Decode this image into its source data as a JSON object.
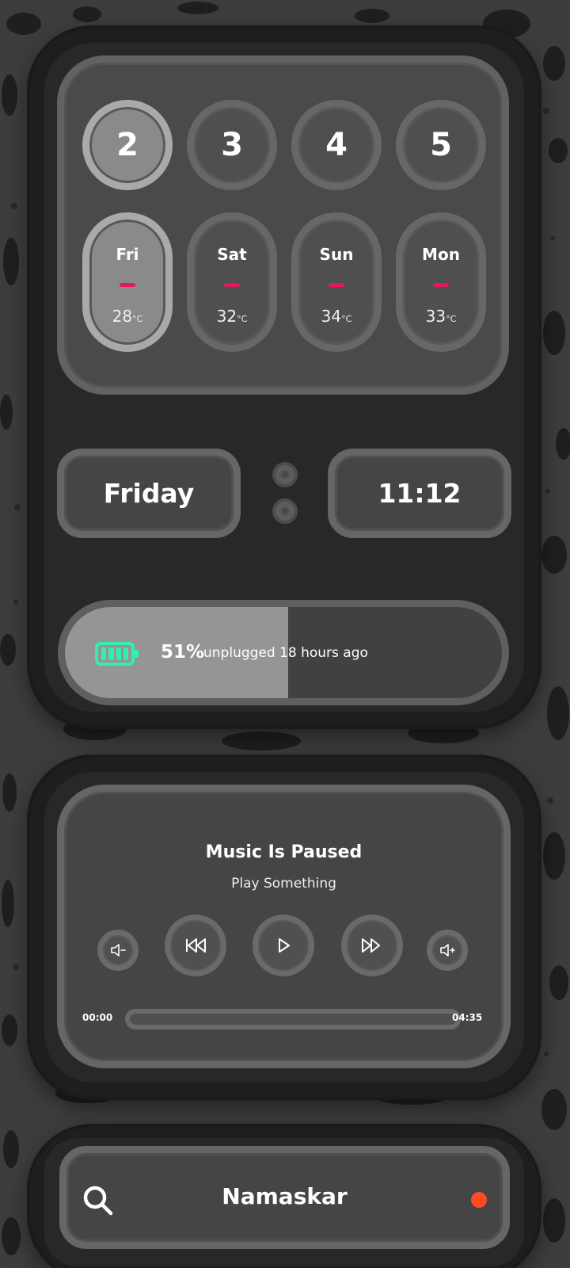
{
  "calendar": {
    "day_numbers": [
      "2",
      "3",
      "4",
      "5"
    ],
    "active_index": 0,
    "days": [
      {
        "name": "Fri",
        "temp": "28",
        "unit": "°C"
      },
      {
        "name": "Sat",
        "temp": "32",
        "unit": "°C"
      },
      {
        "name": "Sun",
        "temp": "34",
        "unit": "°C"
      },
      {
        "name": "Mon",
        "temp": "33",
        "unit": "°C"
      }
    ],
    "indicator_color": "#e6175a"
  },
  "clock": {
    "day": "Friday",
    "time": "11:12"
  },
  "battery": {
    "percent_label": "51%",
    "level": 0.51,
    "status": "unplugged 18 hours ago",
    "icon": "battery-icon",
    "color": "#2ff0b0"
  },
  "music": {
    "title": "Music Is Paused",
    "subtitle": "Play Something",
    "elapsed": "00:00",
    "duration": "04:35",
    "progress": 0,
    "controls": [
      "volume-down-icon",
      "previous-icon",
      "play-icon",
      "next-icon",
      "volume-up-icon"
    ]
  },
  "search": {
    "icon": "search-icon",
    "greeting": "Namaskar",
    "status_color": "#ff4a22"
  }
}
